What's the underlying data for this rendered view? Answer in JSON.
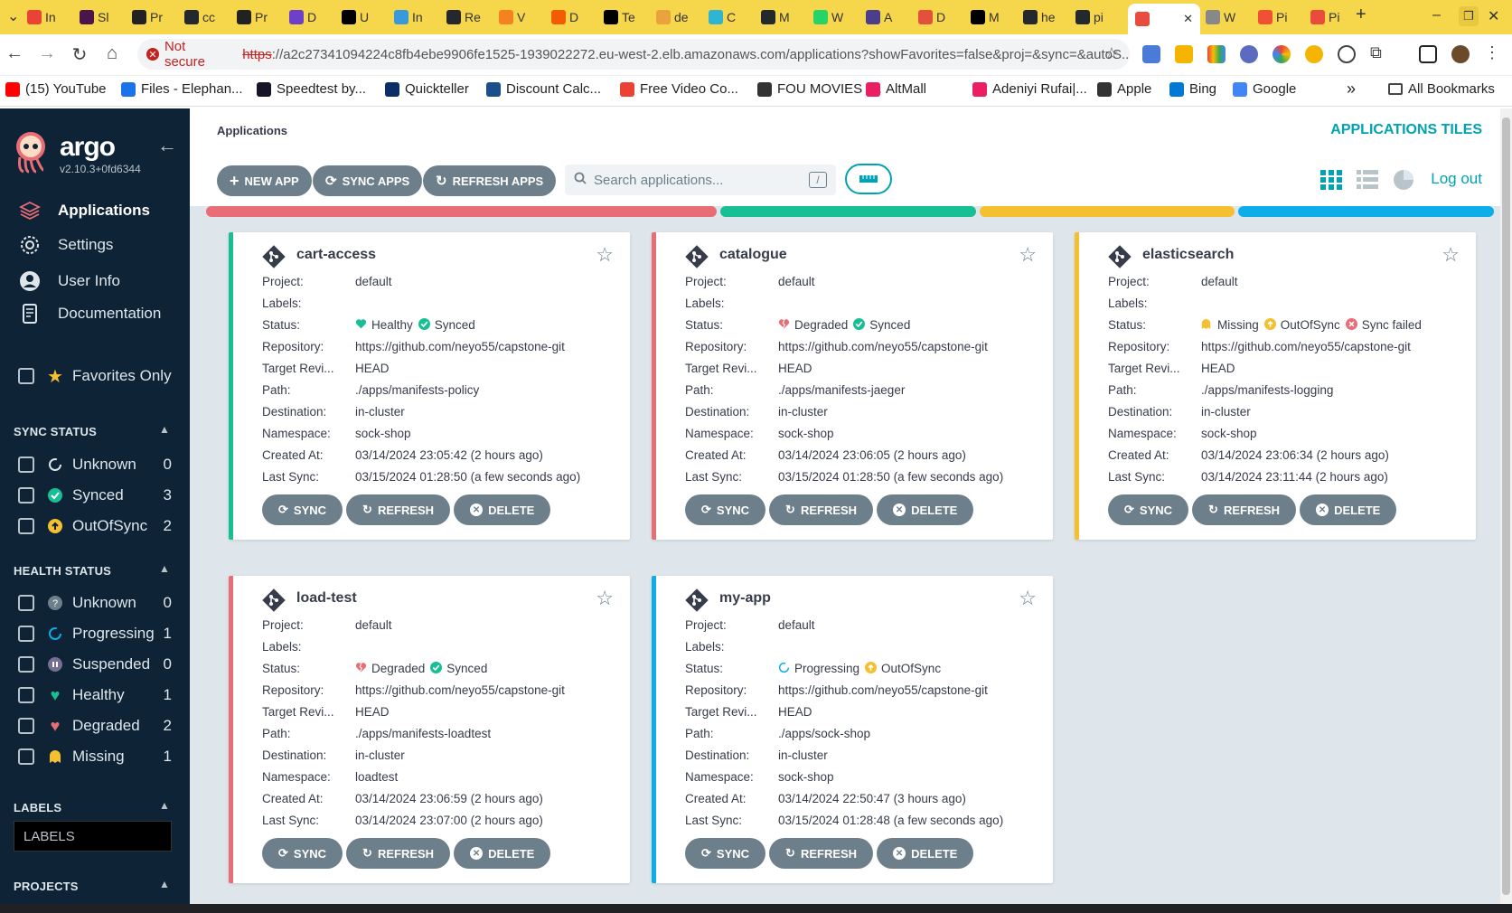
{
  "browser": {
    "tabs": [
      {
        "label": "In",
        "color": "#ea4335"
      },
      {
        "label": "Sl",
        "color": "#4a154b"
      },
      {
        "label": "Pr",
        "color": "#222"
      },
      {
        "label": "cc",
        "color": "#24292e"
      },
      {
        "label": "Pr",
        "color": "#222"
      },
      {
        "label": "D",
        "color": "#6e40c9"
      },
      {
        "label": "U",
        "color": "#000"
      },
      {
        "label": "In",
        "color": "#3a9ad9"
      },
      {
        "label": "Re",
        "color": "#24292e"
      },
      {
        "label": "V",
        "color": "#f58220"
      },
      {
        "label": "D",
        "color": "#f25c05"
      },
      {
        "label": "Te",
        "color": "#000"
      },
      {
        "label": "de",
        "color": "#e8a33d"
      },
      {
        "label": "C",
        "color": "#2fb5d2"
      },
      {
        "label": "M",
        "color": "#24292e"
      },
      {
        "label": "W",
        "color": "#25d366"
      },
      {
        "label": "A",
        "color": "#4b3f8c"
      },
      {
        "label": "D",
        "color": "#e2513c"
      },
      {
        "label": "M",
        "color": "#000"
      },
      {
        "label": "he",
        "color": "#24292e"
      },
      {
        "label": "pi",
        "color": "#24292e"
      },
      {
        "label": "",
        "color": "#e94b3c"
      },
      {
        "label": "W",
        "color": "#888"
      },
      {
        "label": "Pi",
        "color": "#f05133"
      },
      {
        "label": "Pi",
        "color": "#e94b3c"
      }
    ],
    "not_secure": "Not secure",
    "url_scheme": "https",
    "url_rest": "://a2c27341094224c8fb4ebe9906fe1525-1939022272.eu-west-2.elb.amazonaws.com/applications?showFavorites=false&proj=&sync=&autoS...",
    "bookmarks": [
      {
        "label": "(15) YouTube",
        "color": "#ff0000"
      },
      {
        "label": "Files - Elephan...",
        "color": "#1a73e8"
      },
      {
        "label": "Speedtest by...",
        "color": "#141526"
      },
      {
        "label": "Quickteller",
        "color": "#0a2e65"
      },
      {
        "label": "Discount Calc...",
        "color": "#1a4f8b"
      },
      {
        "label": "Free Video Co...",
        "color": "#ea4335"
      },
      {
        "label": "FOU MOVIES -...",
        "color": "#333"
      },
      {
        "label": "AltMall",
        "color": "#e91e63"
      },
      {
        "label": "Adeniyi Rufai|...",
        "color": "#e91e63"
      },
      {
        "label": "Apple",
        "color": "#333"
      },
      {
        "label": "Bing",
        "color": "#0078d4"
      },
      {
        "label": "Google",
        "color": "#4285f4"
      }
    ],
    "all_bookmarks": "All Bookmarks"
  },
  "sidebar": {
    "logo_text": "argo",
    "version": "v2.10.3+0fd6344",
    "nav": [
      {
        "label": "Applications",
        "icon": "layers-icon"
      },
      {
        "label": "Settings",
        "icon": "gear-icon"
      },
      {
        "label": "User Info",
        "icon": "user-icon"
      },
      {
        "label": "Documentation",
        "icon": "book-icon"
      }
    ],
    "favorites_only": "Favorites Only",
    "sync_status": {
      "title": "SYNC STATUS",
      "items": [
        {
          "label": "Unknown",
          "count": "0"
        },
        {
          "label": "Synced",
          "count": "3"
        },
        {
          "label": "OutOfSync",
          "count": "2"
        }
      ]
    },
    "health_status": {
      "title": "HEALTH STATUS",
      "items": [
        {
          "label": "Unknown",
          "count": "0"
        },
        {
          "label": "Progressing",
          "count": "1"
        },
        {
          "label": "Suspended",
          "count": "0"
        },
        {
          "label": "Healthy",
          "count": "1"
        },
        {
          "label": "Degraded",
          "count": "2"
        },
        {
          "label": "Missing",
          "count": "1"
        }
      ]
    },
    "labels_title": "LABELS",
    "labels_placeholder": "LABELS",
    "projects_title": "PROJECTS"
  },
  "header": {
    "breadcrumb": "Applications",
    "title": "APPLICATIONS TILES",
    "new_app": "NEW APP",
    "sync_apps": "SYNC APPS",
    "refresh_apps": "REFRESH APPS",
    "search_placeholder": "Search applications...",
    "search_shortcut": "/",
    "logout": "Log out"
  },
  "status_colors": {
    "degraded": "#e96d76",
    "healthy": "#18be94",
    "missing": "#f4c030",
    "progressing": "#0dadea",
    "outofsync": "#f4c030",
    "failed": "#e96d76"
  },
  "field_labels": {
    "project": "Project:",
    "labels": "Labels:",
    "status": "Status:",
    "repository": "Repository:",
    "target_revision": "Target Revi...",
    "path": "Path:",
    "destination": "Destination:",
    "namespace": "Namespace:",
    "created_at": "Created At:",
    "last_sync": "Last Sync:"
  },
  "buttons": {
    "sync": "SYNC",
    "refresh": "REFRESH",
    "delete": "DELETE"
  },
  "apps": [
    {
      "name": "cart-access",
      "border": "#18be94",
      "project": "default",
      "labels": "",
      "health": "Healthy",
      "health_icon": "heart-icon",
      "health_color": "#18be94",
      "sync": "Synced",
      "sync_icon": "check-circle-icon",
      "sync_color": "#18be94",
      "extra": "",
      "repository": "https://github.com/neyo55/capstone-git",
      "target_revision": "HEAD",
      "path": "./apps/manifests-policy",
      "destination": "in-cluster",
      "namespace": "sock-shop",
      "created_at": "03/14/2024 23:05:42  (2 hours ago)",
      "last_sync": "03/15/2024 01:28:50  (a few seconds ago)"
    },
    {
      "name": "catalogue",
      "border": "#e96d76",
      "project": "default",
      "labels": "",
      "health": "Degraded",
      "health_icon": "broken-heart-icon",
      "health_color": "#e96d76",
      "sync": "Synced",
      "sync_icon": "check-circle-icon",
      "sync_color": "#18be94",
      "extra": "",
      "repository": "https://github.com/neyo55/capstone-git",
      "target_revision": "HEAD",
      "path": "./apps/manifests-jaeger",
      "destination": "in-cluster",
      "namespace": "sock-shop",
      "created_at": "03/14/2024 23:06:05  (2 hours ago)",
      "last_sync": "03/15/2024 01:28:50  (a few seconds ago)"
    },
    {
      "name": "elasticsearch",
      "border": "#f4c030",
      "project": "default",
      "labels": "",
      "health": "Missing",
      "health_icon": "ghost-icon",
      "health_color": "#f4c030",
      "sync": "OutOfSync",
      "sync_icon": "arrow-up-circle-icon",
      "sync_color": "#f4c030",
      "extra": "Sync failed",
      "repository": "https://github.com/neyo55/capstone-git",
      "target_revision": "HEAD",
      "path": "./apps/manifests-logging",
      "destination": "in-cluster",
      "namespace": "sock-shop",
      "created_at": "03/14/2024 23:06:34  (2 hours ago)",
      "last_sync": "03/14/2024 23:11:44  (2 hours ago)"
    },
    {
      "name": "load-test",
      "border": "#e96d76",
      "project": "default",
      "labels": "",
      "health": "Degraded",
      "health_icon": "broken-heart-icon",
      "health_color": "#e96d76",
      "sync": "Synced",
      "sync_icon": "check-circle-icon",
      "sync_color": "#18be94",
      "extra": "",
      "repository": "https://github.com/neyo55/capstone-git",
      "target_revision": "HEAD",
      "path": "./apps/manifests-loadtest",
      "destination": "in-cluster",
      "namespace": "loadtest",
      "created_at": "03/14/2024 23:06:59  (2 hours ago)",
      "last_sync": "03/14/2024 23:07:00  (2 hours ago)"
    },
    {
      "name": "my-app",
      "border": "#0dadea",
      "project": "default",
      "labels": "",
      "health": "Progressing",
      "health_icon": "spinner-icon",
      "health_color": "#0dadea",
      "sync": "OutOfSync",
      "sync_icon": "arrow-up-circle-icon",
      "sync_color": "#f4c030",
      "extra": "",
      "repository": "https://github.com/neyo55/capstone-git",
      "target_revision": "HEAD",
      "path": "./apps/sock-shop",
      "destination": "in-cluster",
      "namespace": "sock-shop",
      "created_at": "03/14/2024 22:50:47  (3 hours ago)",
      "last_sync": "03/15/2024 01:28:48  (a few seconds ago)"
    }
  ]
}
